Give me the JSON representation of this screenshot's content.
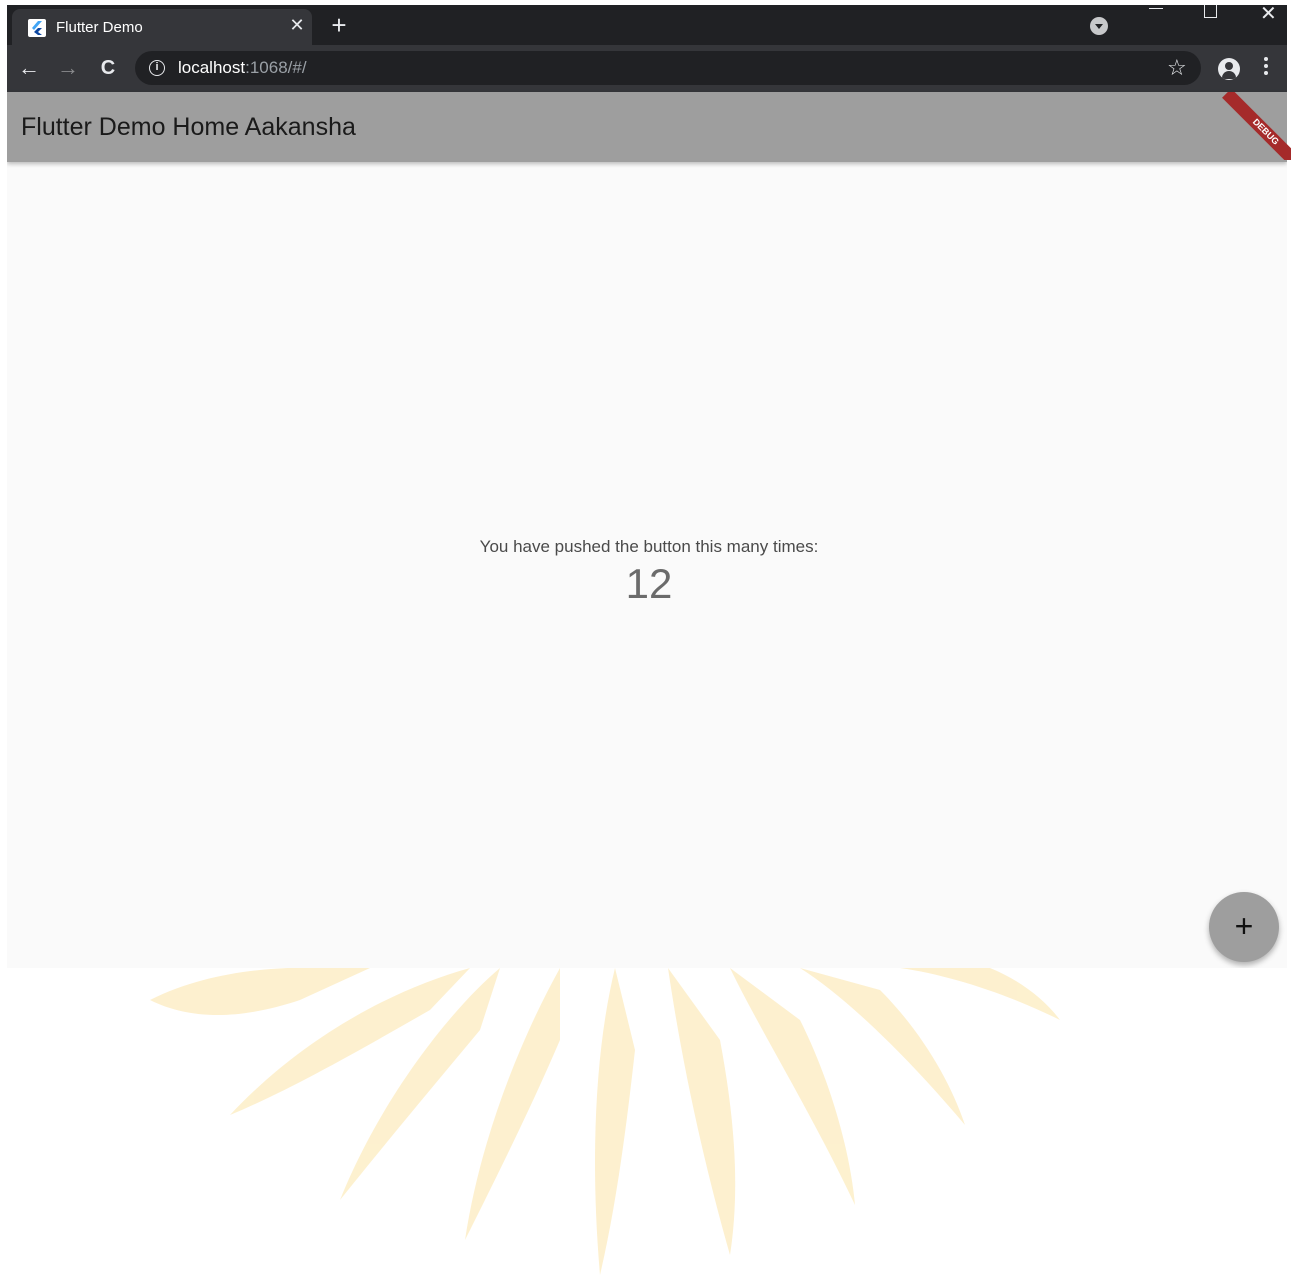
{
  "browser": {
    "tab_title": "Flutter Demo",
    "tab_close": "✕",
    "new_tab": "+",
    "url_host": "localhost",
    "url_rest": ":1068/#/",
    "info_glyph": "i",
    "star_glyph": "☆",
    "back_glyph": "←",
    "forward_glyph": "→",
    "reload_glyph": "C",
    "window_close_glyph": "✕"
  },
  "app": {
    "title": "Flutter Demo Home Aakansha",
    "debug_label": "DEBUG",
    "counter_label": "You have pushed the button this many times:",
    "counter_value": "12",
    "fab_glyph": "+"
  },
  "colors": {
    "appbar": "#9e9e9e",
    "debug_ribbon": "#a52a2a",
    "watermark": "#fde9b8"
  }
}
